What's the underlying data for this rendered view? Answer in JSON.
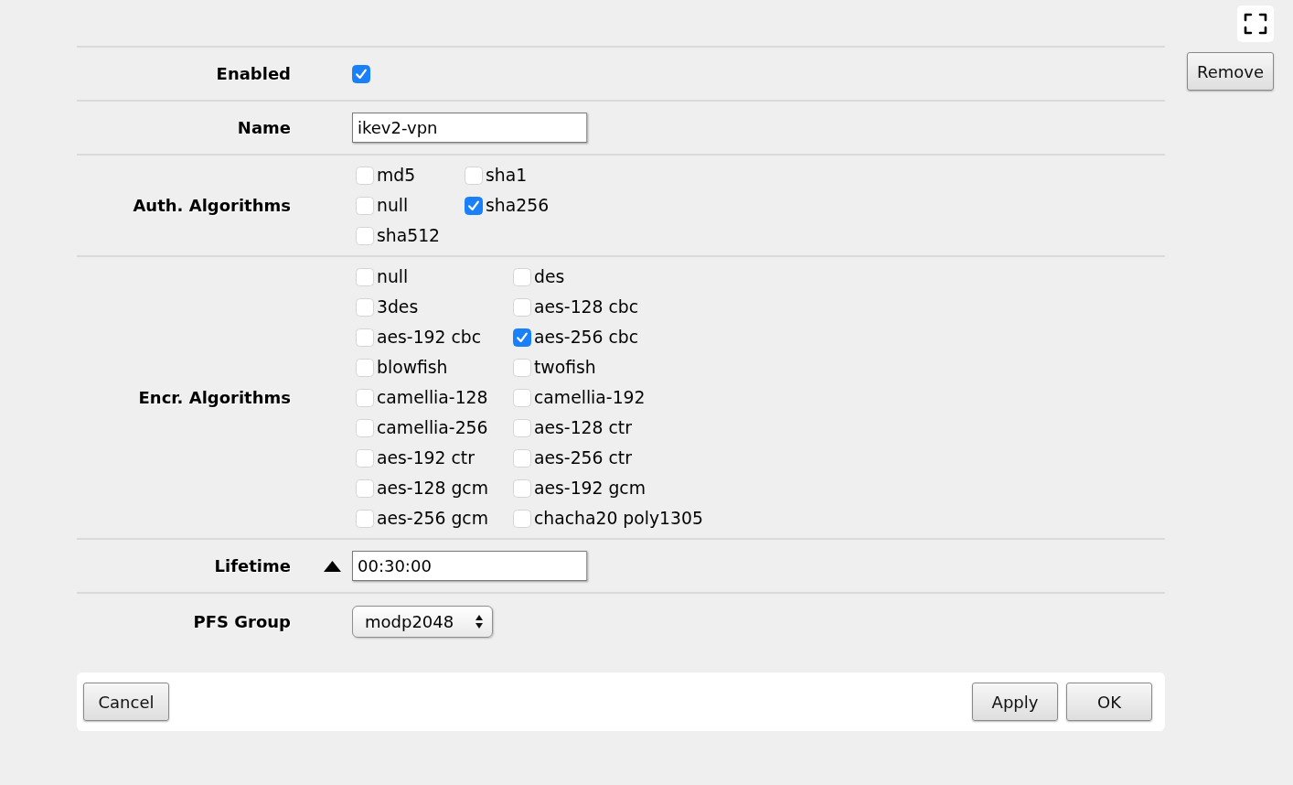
{
  "side": {
    "remove_button": "Remove"
  },
  "form": {
    "rows": [
      {
        "kind": "checkbox",
        "label": "Enabled",
        "checked": true
      },
      {
        "kind": "text",
        "label": "Name",
        "value": "ikev2-vpn"
      },
      {
        "kind": "checkbox_group",
        "label": "Auth. Algorithms",
        "options": [
          {
            "label": "md5",
            "checked": false
          },
          {
            "label": "sha1",
            "checked": false
          },
          {
            "label": "null",
            "checked": false
          },
          {
            "label": "sha256",
            "checked": true
          },
          {
            "label": "sha512",
            "checked": false
          }
        ]
      },
      {
        "kind": "checkbox_group",
        "label": "Encr. Algorithms",
        "options": [
          {
            "label": "null",
            "checked": false
          },
          {
            "label": "des",
            "checked": false
          },
          {
            "label": "3des",
            "checked": false
          },
          {
            "label": "aes-128 cbc",
            "checked": false
          },
          {
            "label": "aes-192 cbc",
            "checked": false
          },
          {
            "label": "aes-256 cbc",
            "checked": true
          },
          {
            "label": "blowfish",
            "checked": false
          },
          {
            "label": "twofish",
            "checked": false
          },
          {
            "label": "camellia-128",
            "checked": false
          },
          {
            "label": "camellia-192",
            "checked": false
          },
          {
            "label": "camellia-256",
            "checked": false
          },
          {
            "label": "aes-128 ctr",
            "checked": false
          },
          {
            "label": "aes-192 ctr",
            "checked": false
          },
          {
            "label": "aes-256 ctr",
            "checked": false
          },
          {
            "label": "aes-128 gcm",
            "checked": false
          },
          {
            "label": "aes-192 gcm",
            "checked": false
          },
          {
            "label": "aes-256 gcm",
            "checked": false
          },
          {
            "label": "chacha20 poly1305",
            "checked": false
          }
        ]
      },
      {
        "kind": "text",
        "label": "Lifetime",
        "value": "00:30:00",
        "toggle": true
      },
      {
        "kind": "select",
        "label": "PFS Group",
        "value": "modp2048"
      }
    ]
  },
  "footer": {
    "cancel_button": "Cancel",
    "apply_button": "Apply",
    "ok_button": "OK"
  }
}
